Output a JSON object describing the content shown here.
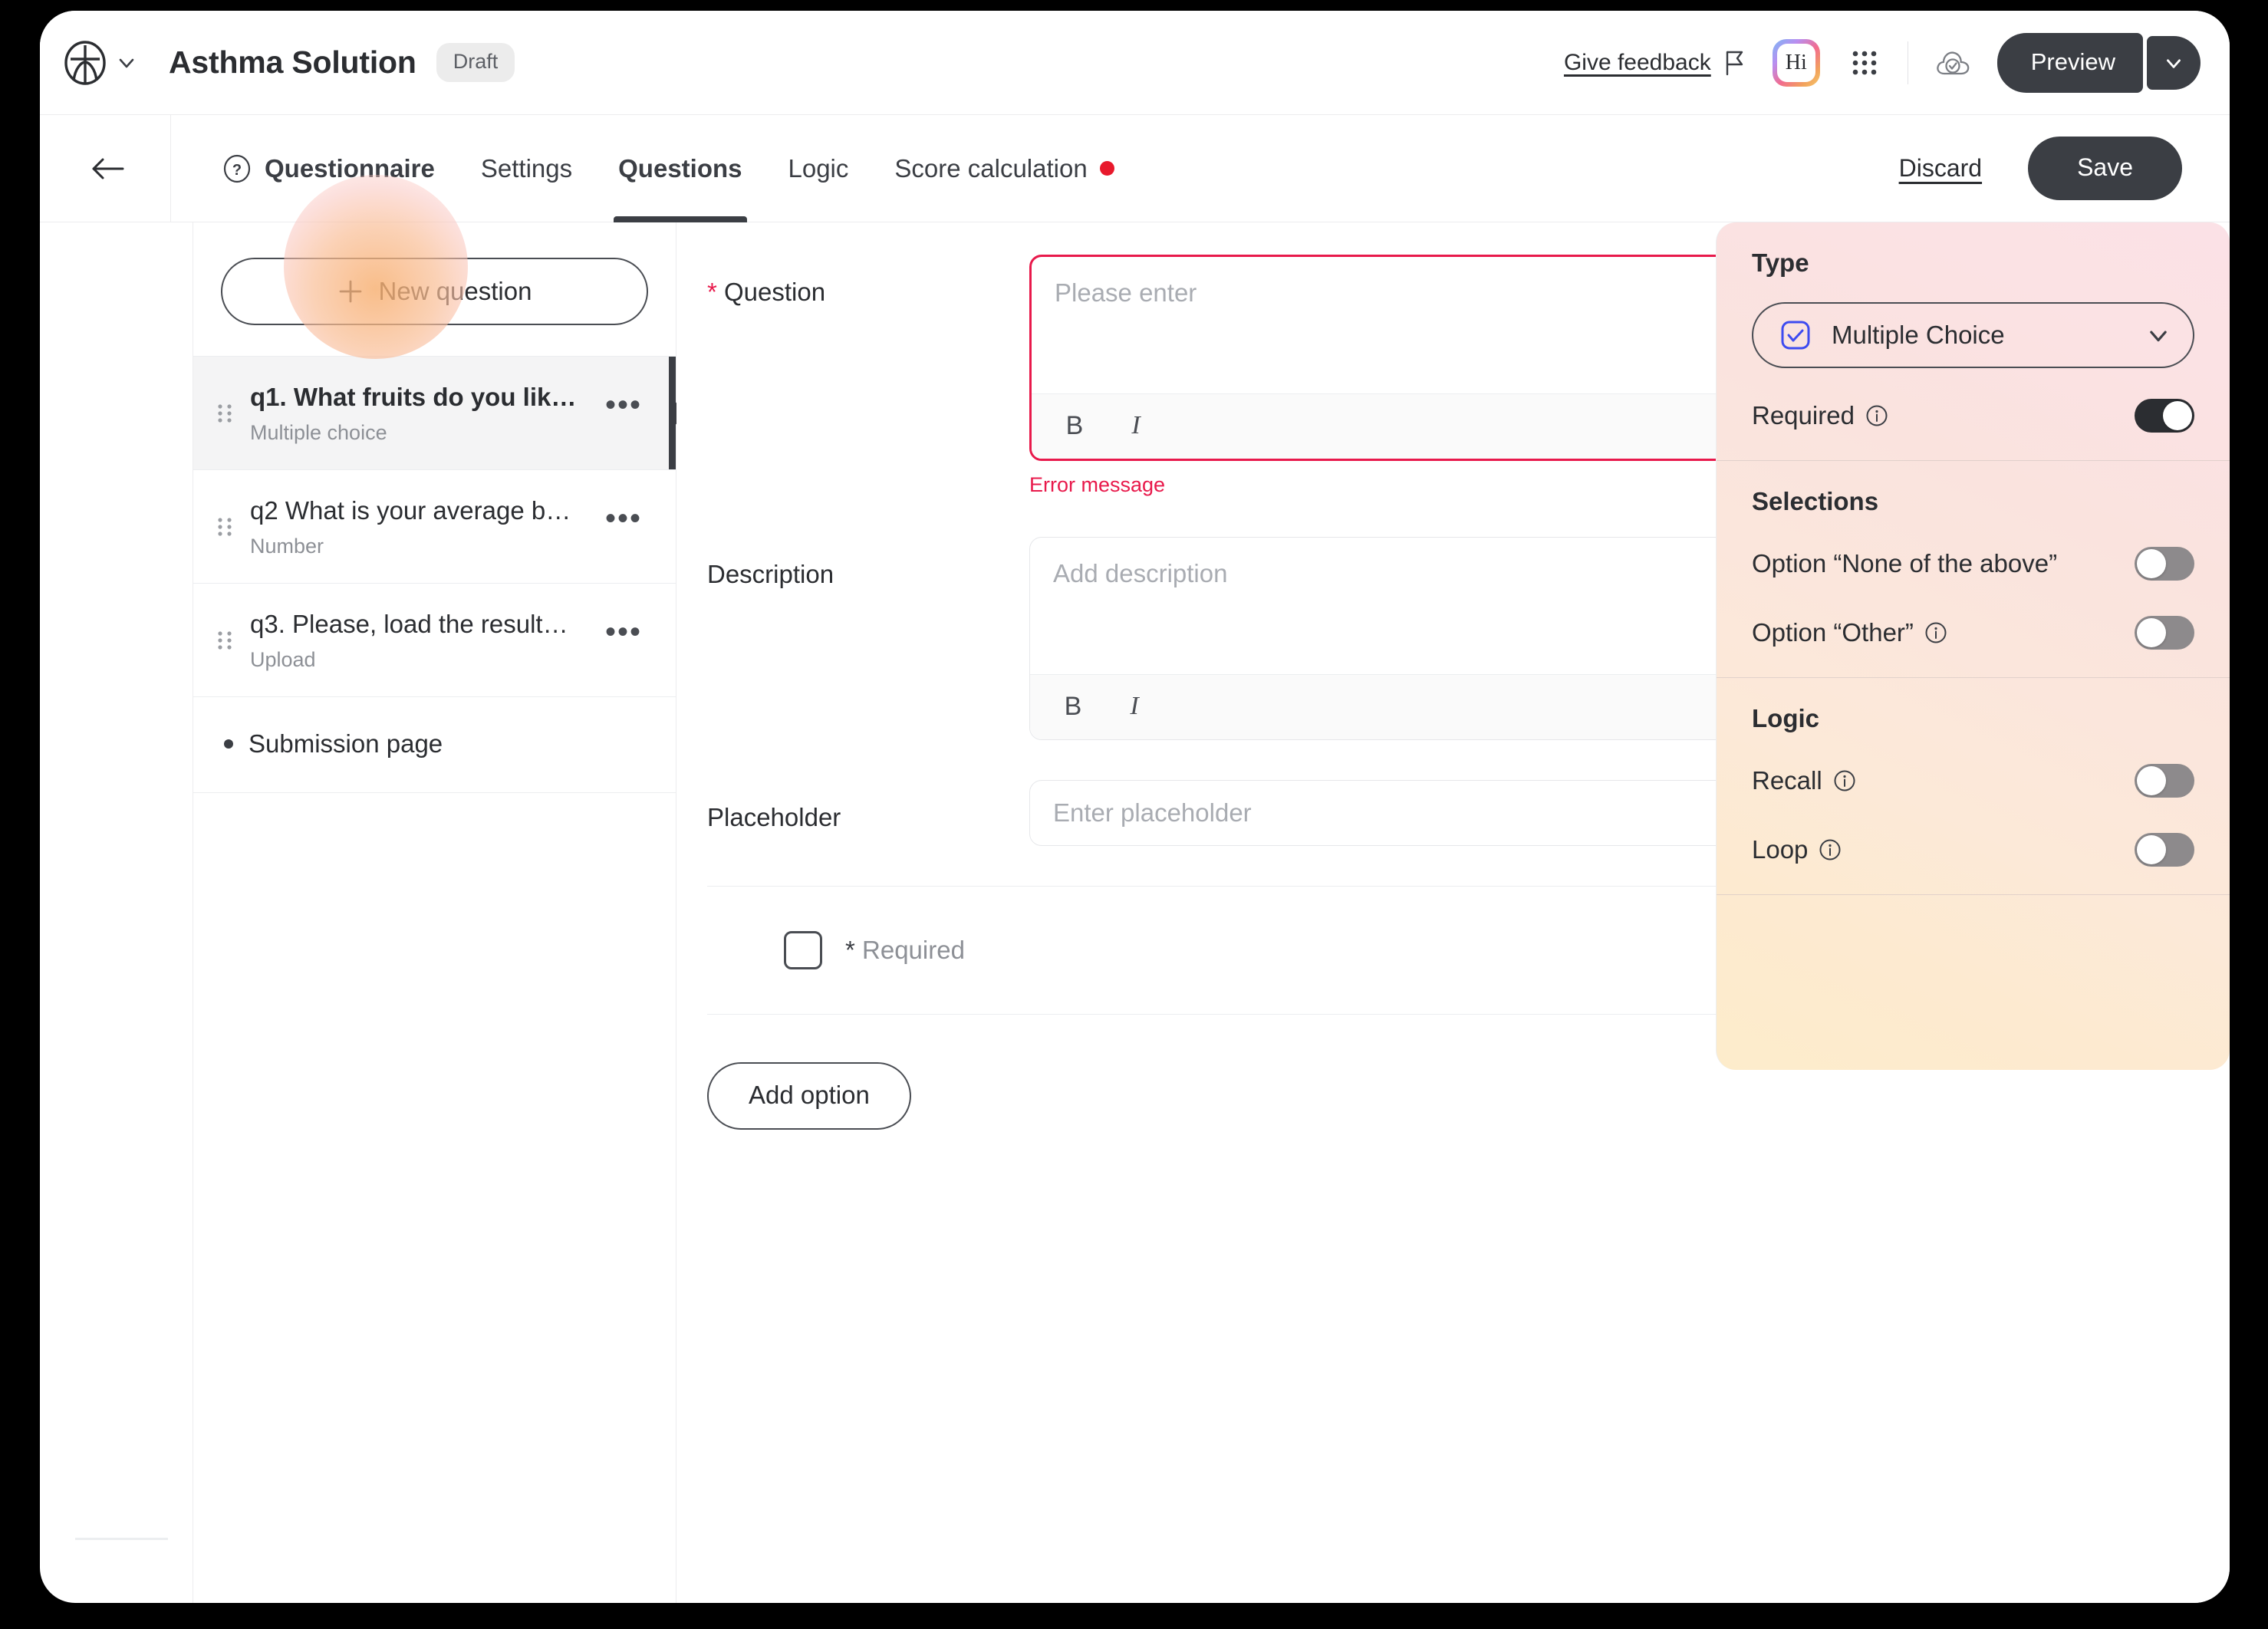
{
  "topbar": {
    "logo_icon": "brand-circle-icon",
    "logo_caret_icon": "chevron-down-icon",
    "app_title": "Asthma Solution",
    "status_badge": "Draft",
    "give_feedback": "Give feedback",
    "flag_icon": "flag-icon",
    "assistant_badge": "Hi",
    "apps_icon": "apps-grid-icon",
    "cloud_icon": "cloud-check-icon",
    "preview_label": "Preview",
    "preview_caret_icon": "chevron-down-icon"
  },
  "tabbar": {
    "back_icon": "arrow-left-icon",
    "tabs": [
      {
        "label": "Questionnaire",
        "icon": "question-circle-icon",
        "bold": true,
        "active": false,
        "dot": false
      },
      {
        "label": "Settings",
        "icon": "",
        "bold": false,
        "active": false,
        "dot": false
      },
      {
        "label": "Questions",
        "icon": "",
        "bold": true,
        "active": true,
        "dot": false
      },
      {
        "label": "Logic",
        "icon": "",
        "bold": false,
        "active": false,
        "dot": false
      },
      {
        "label": "Score calculation",
        "icon": "",
        "bold": false,
        "active": false,
        "dot": true
      }
    ],
    "discard_label": "Discard",
    "save_label": "Save",
    "dot_color": "#e8192c"
  },
  "question_list": {
    "new_question_label": "New question",
    "plus_icon": "plus-icon",
    "more_icon": "ellipsis-icon",
    "drag_icon": "drag-handle-icon",
    "items": [
      {
        "title": "q1. What fruits do you lik…",
        "type": "Multiple choice",
        "selected": true
      },
      {
        "title": "q2 What is your average b…",
        "type": "Number",
        "selected": false
      },
      {
        "title": "q3. Please, load the result…",
        "type": "Upload",
        "selected": false
      }
    ],
    "submission_page_label": "Submission page"
  },
  "editor": {
    "question_label": "Question",
    "question_required_mark": "*",
    "question_placeholder": "Please enter",
    "question_value": "",
    "error_message": "Error message",
    "description_label": "Description",
    "description_placeholder": "Add description",
    "description_value": "",
    "placeholder_label": "Placeholder",
    "placeholder_placeholder": "Enter placeholder",
    "placeholder_value": "",
    "rte_bold_label": "B",
    "rte_italic_label": "I",
    "option_star": "*",
    "option_label": "Required",
    "trash_icon": "trash-icon",
    "option_drag_icon": "drag-handle-icon",
    "add_option_label": "Add option",
    "error_color": "#e8194b"
  },
  "settings_panel": {
    "type": {
      "title": "Type",
      "selected_value": "Multiple Choice",
      "select_icon": "checkbox-check-icon",
      "caret_icon": "chevron-down-icon",
      "required_label": "Required",
      "required_info_icon": "info-icon",
      "required_on": true
    },
    "selections": {
      "title": "Selections",
      "rows": [
        {
          "label": "Option “None of the above”",
          "info": false,
          "on": false
        },
        {
          "label": "Option “Other”",
          "info": true,
          "on": false
        }
      ]
    },
    "logic": {
      "title": "Logic",
      "rows": [
        {
          "label": "Recall",
          "info": true,
          "on": false
        },
        {
          "label": "Loop",
          "info": true,
          "on": false
        }
      ]
    },
    "accent_gradient_from": "#fbe1e6",
    "accent_gradient_to": "#fdeccb"
  }
}
